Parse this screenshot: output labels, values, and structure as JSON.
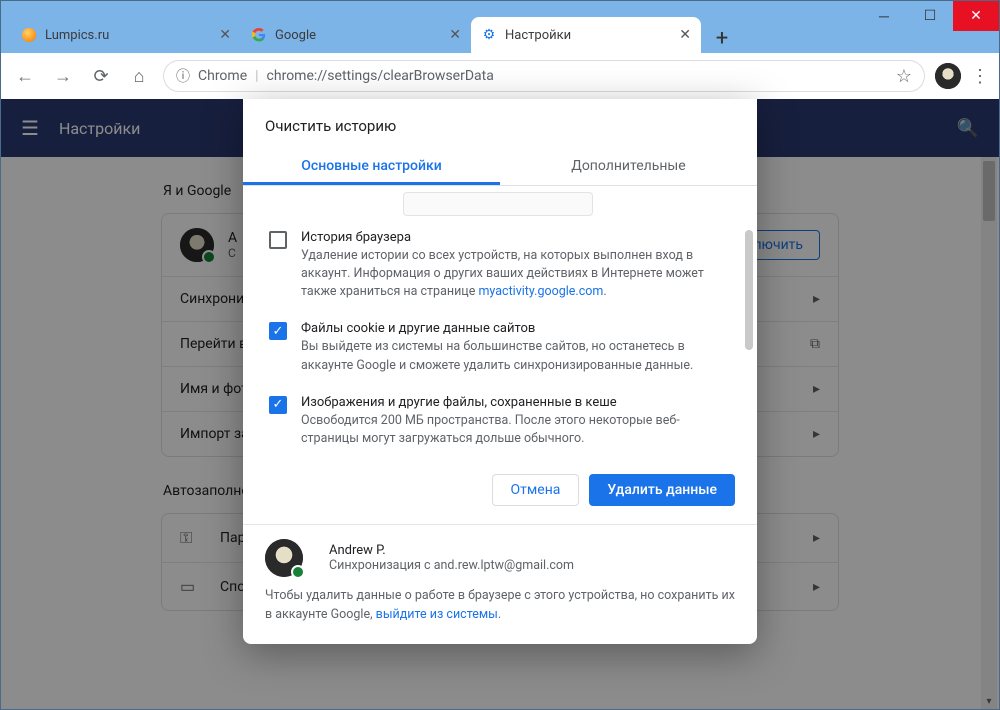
{
  "window": {
    "tabs": [
      {
        "title": "Lumpics.ru"
      },
      {
        "title": "Google"
      },
      {
        "title": "Настройки"
      }
    ]
  },
  "toolbar": {
    "secure_label": "Chrome",
    "url": "chrome://settings/clearBrowserData"
  },
  "settings": {
    "app_title": "Настройки",
    "section_me_google": "Я и Google",
    "sync_btn": "Включить",
    "rows": {
      "sync": "Синхрониз",
      "goto": "Перейти в",
      "name_photo": "Имя и фот",
      "import": "Импорт за"
    },
    "user_initial": "A",
    "user_line2": "С",
    "section_autofill": "Автозаполне",
    "autofill_rows": {
      "passwords": "Пар",
      "cards": "Спо"
    }
  },
  "dialog": {
    "title": "Очистить историю",
    "tabs": {
      "basic": "Основные настройки",
      "advanced": "Дополнительные"
    },
    "options": [
      {
        "checked": false,
        "title": "История браузера",
        "desc_pre": "Удаление истории со всех устройств, на которых выполнен вход в аккаунт. Информация о других ваших действиях в Интернете может также храниться на странице ",
        "link": "myactivity.google.com",
        "desc_post": "."
      },
      {
        "checked": true,
        "title": "Файлы cookie и другие данные сайтов",
        "desc": "Вы выйдете из системы на большинстве сайтов, но останетесь в аккаунте Google и сможете удалить синхронизированные данные."
      },
      {
        "checked": true,
        "title": "Изображения и другие файлы, сохраненные в кеше",
        "desc": "Освободится 200 МБ пространства. После этого некоторые веб-страницы могут загружаться дольше обычного."
      }
    ],
    "cancel": "Отмена",
    "confirm": "Удалить данные",
    "user": {
      "name": "Andrew P.",
      "sync_pre": "Синхронизация с ",
      "email": "and.rew.lptw@gmail.com"
    },
    "signout_pre": "Чтобы удалить данные о работе в браузере с этого устройства, но сохранить их в аккаунте Google, ",
    "signout_link": "выйдите из системы",
    "signout_post": "."
  }
}
